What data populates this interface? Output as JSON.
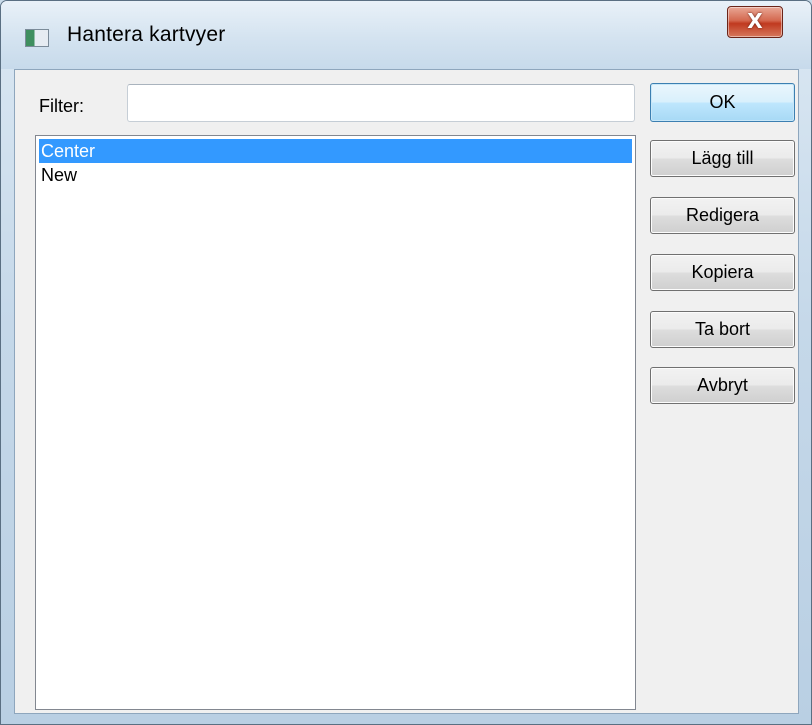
{
  "window": {
    "title": "Hantera kartvyer",
    "close_label": "X"
  },
  "filter": {
    "label": "Filter:",
    "value": "",
    "placeholder": ""
  },
  "list": {
    "items": [
      {
        "label": "Center",
        "selected": true
      },
      {
        "label": "New",
        "selected": false
      }
    ]
  },
  "buttons": {
    "ok": "OK",
    "add": "Lägg till",
    "edit": "Redigera",
    "copy": "Kopiera",
    "delete": "Ta bort",
    "cancel": "Avbryt"
  },
  "colors": {
    "selection": "#3399ff",
    "close_button": "#c0391f",
    "default_button_border": "#3c7fb1"
  },
  "icons": {
    "app": "window-app-icon",
    "close": "close-icon"
  }
}
